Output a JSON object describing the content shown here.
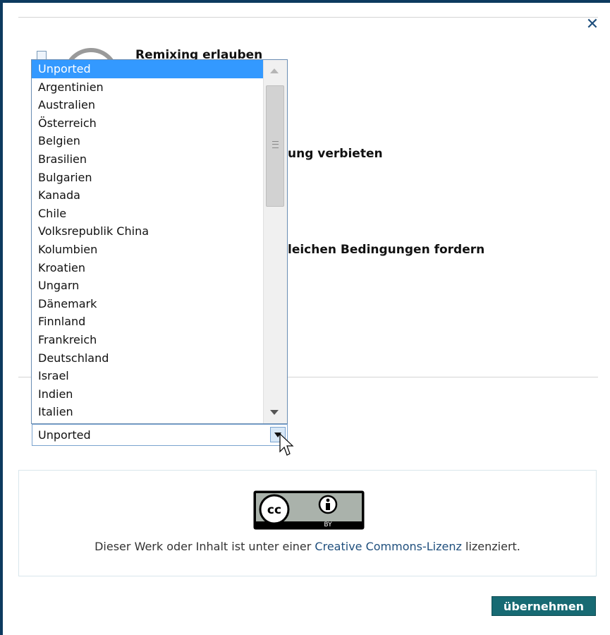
{
  "dialog": {
    "close_symbol": "✕"
  },
  "options": {
    "remix": "Remixing erlauben",
    "commercial": "ung verbieten",
    "sharealike": "leichen Bedingungen fordern"
  },
  "jurisdiction": {
    "selected": "Unported",
    "items": [
      "Unported",
      "Argentinien",
      "Australien",
      "Österreich",
      "Belgien",
      "Brasilien",
      "Bulgarien",
      "Kanada",
      "Chile",
      "Volksrepublik China",
      "Kolumbien",
      "Kroatien",
      "Ungarn",
      "Dänemark",
      "Finnland",
      "Frankreich",
      "Deutschland",
      "Israel",
      "Indien",
      "Italien"
    ]
  },
  "license": {
    "badge_cc": "cc",
    "badge_by": "BY",
    "text_before": "Dieser Werk oder Inhalt ist unter einer ",
    "link_text": "Creative Commons-Lizenz",
    "text_after": " lizenziert."
  },
  "footer": {
    "apply_label": "übernehmen"
  },
  "colors": {
    "frame": "#0d3a5f",
    "selected_item": "#3399ff",
    "apply_button": "#176a73",
    "link": "#1f4f7d"
  }
}
